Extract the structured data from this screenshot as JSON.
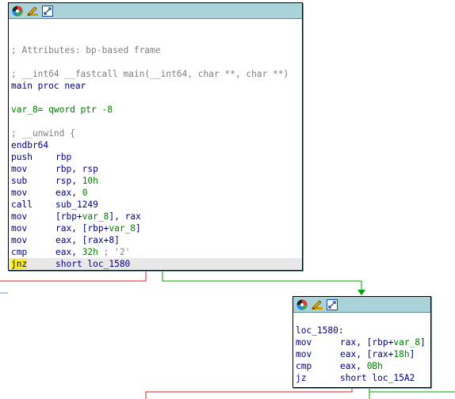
{
  "block_main": {
    "header_icons": [
      "color-palette-icon",
      "rename-pencil-icon",
      "graph-zoom-icon"
    ],
    "lines": [
      {
        "text": "; Attributes: bp-based frame",
        "kind": "comment"
      },
      {
        "text": "; __int64 __fastcall main(__int64, char **, char **)",
        "kind": "comment"
      },
      {
        "text": "main proc near",
        "kind": "label"
      },
      {
        "text": "var_8= qword ptr -8",
        "kind": "var"
      },
      {
        "text": "; __unwind {",
        "kind": "comment"
      },
      {
        "text": "endbr64",
        "kind": "label"
      }
    ],
    "instructions": [
      {
        "mnem": "push",
        "op": "rbp"
      },
      {
        "mnem": "mov",
        "op": "rbp, rsp"
      },
      {
        "mnem": "sub",
        "op_pre": "rsp, ",
        "num": "10h"
      },
      {
        "mnem": "mov",
        "op_pre": "eax, ",
        "num": "0"
      },
      {
        "mnem": "call",
        "op": "sub_1249"
      },
      {
        "mnem": "mov",
        "op_pre": "[rbp+",
        "var": "var_8",
        "op_post": "], rax"
      },
      {
        "mnem": "mov",
        "op_pre": "rax, [rbp+",
        "var": "var_8",
        "op_post": "]"
      },
      {
        "mnem": "mov",
        "op": "eax, [rax+8]"
      },
      {
        "mnem": "cmp",
        "op_pre": "eax, ",
        "num": "32h",
        "comment": " ; '2'"
      },
      {
        "mnem": "jnz",
        "op": "short loc_1580"
      }
    ]
  },
  "block_loc": {
    "label": "loc_1580:",
    "instructions": [
      {
        "mnem": "mov",
        "op_pre": "rax, [rbp+",
        "var": "var_8",
        "op_post": "]"
      },
      {
        "mnem": "mov",
        "op_pre": "eax, [rax+",
        "num": "18h",
        "op_post": "]"
      },
      {
        "mnem": "cmp",
        "op_pre": "eax, ",
        "num": "0Bh"
      },
      {
        "mnem": "jz",
        "op": "short loc_15A2"
      }
    ]
  },
  "colors": {
    "header": "#a9d3d8",
    "edge_true": "#00a000",
    "edge_false": "#e02020",
    "edge_plain": "#5aa7c8",
    "highlight": "#fff200"
  }
}
